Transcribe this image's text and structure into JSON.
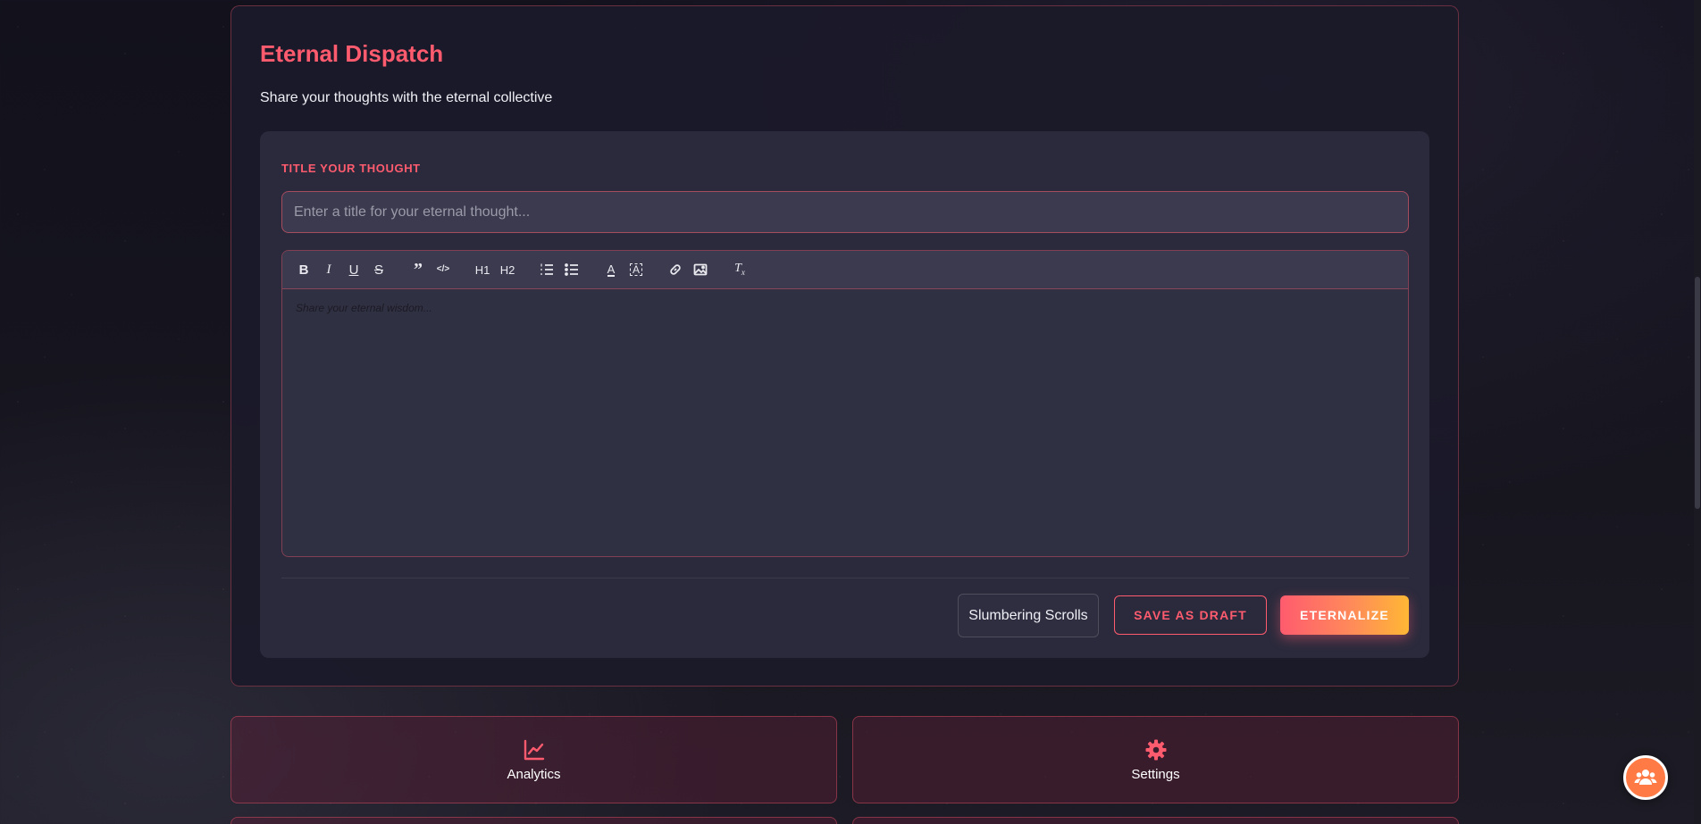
{
  "card": {
    "title": "Eternal Dispatch",
    "subtitle": "Share your thoughts with the eternal collective"
  },
  "form": {
    "title_label": "TITLE YOUR THOUGHT",
    "title_placeholder": "Enter a title for your eternal thought...",
    "title_value": "",
    "editor_placeholder": "Share your eternal wisdom...",
    "toolbar": [
      {
        "name": "bold",
        "label": "B"
      },
      {
        "name": "italic",
        "label": "I"
      },
      {
        "name": "underline",
        "label": "U"
      },
      {
        "name": "strikethrough",
        "label": "S"
      },
      {
        "name": "blockquote",
        "label": "”"
      },
      {
        "name": "code-block",
        "label": "</>"
      },
      {
        "name": "heading-1",
        "label": "H1"
      },
      {
        "name": "heading-2",
        "label": "H2"
      },
      {
        "name": "ordered-list",
        "label": "ordered list"
      },
      {
        "name": "bullet-list",
        "label": "bullet list"
      },
      {
        "name": "text-color",
        "label": "A"
      },
      {
        "name": "background-color",
        "label": "A"
      },
      {
        "name": "link",
        "label": "link"
      },
      {
        "name": "image",
        "label": "image"
      },
      {
        "name": "clear-format",
        "label": "Tx"
      }
    ]
  },
  "actions": {
    "scrolls_label": "Slumbering Scrolls",
    "draft_label": "SAVE AS DRAFT",
    "eternalize_label": "ETERNALIZE"
  },
  "tiles": [
    {
      "label": "Analytics",
      "icon": "chart-line-icon"
    },
    {
      "label": "Settings",
      "icon": "gear-icon"
    }
  ],
  "fab": {
    "icon": "users-icon"
  },
  "colors": {
    "accent": "#ff5b6e",
    "gradient_end": "#ffb735",
    "fab": "#ff7a45"
  }
}
